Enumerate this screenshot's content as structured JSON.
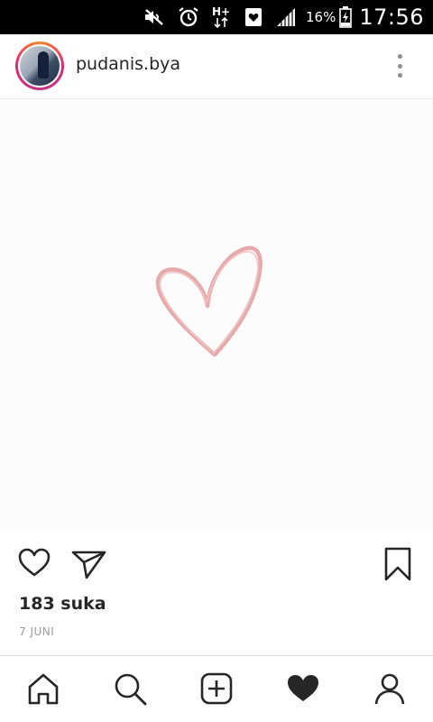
{
  "status_bar": {
    "icons": [
      "mute-icon",
      "alarm-icon",
      "hplus-data-icon",
      "notification-heart-icon",
      "signal-icon",
      "battery-icon"
    ],
    "battery_text": "16%",
    "time": "17:56"
  },
  "post": {
    "username": "pudanis.bya",
    "avatar_icon": "profile-photo",
    "image_icon": "hand-drawn-heart",
    "likes": "183 suka",
    "date": "7 JUNI",
    "heart_color": "#e4a1a1"
  },
  "actions": {
    "like_icon": "heart-outline-icon",
    "share_icon": "paper-plane-icon",
    "save_icon": "bookmark-icon"
  },
  "bottom_nav": {
    "items": [
      "home-icon",
      "search-icon",
      "add-post-icon",
      "activity-heart-icon",
      "profile-icon"
    ],
    "active": "activity-heart-icon"
  }
}
